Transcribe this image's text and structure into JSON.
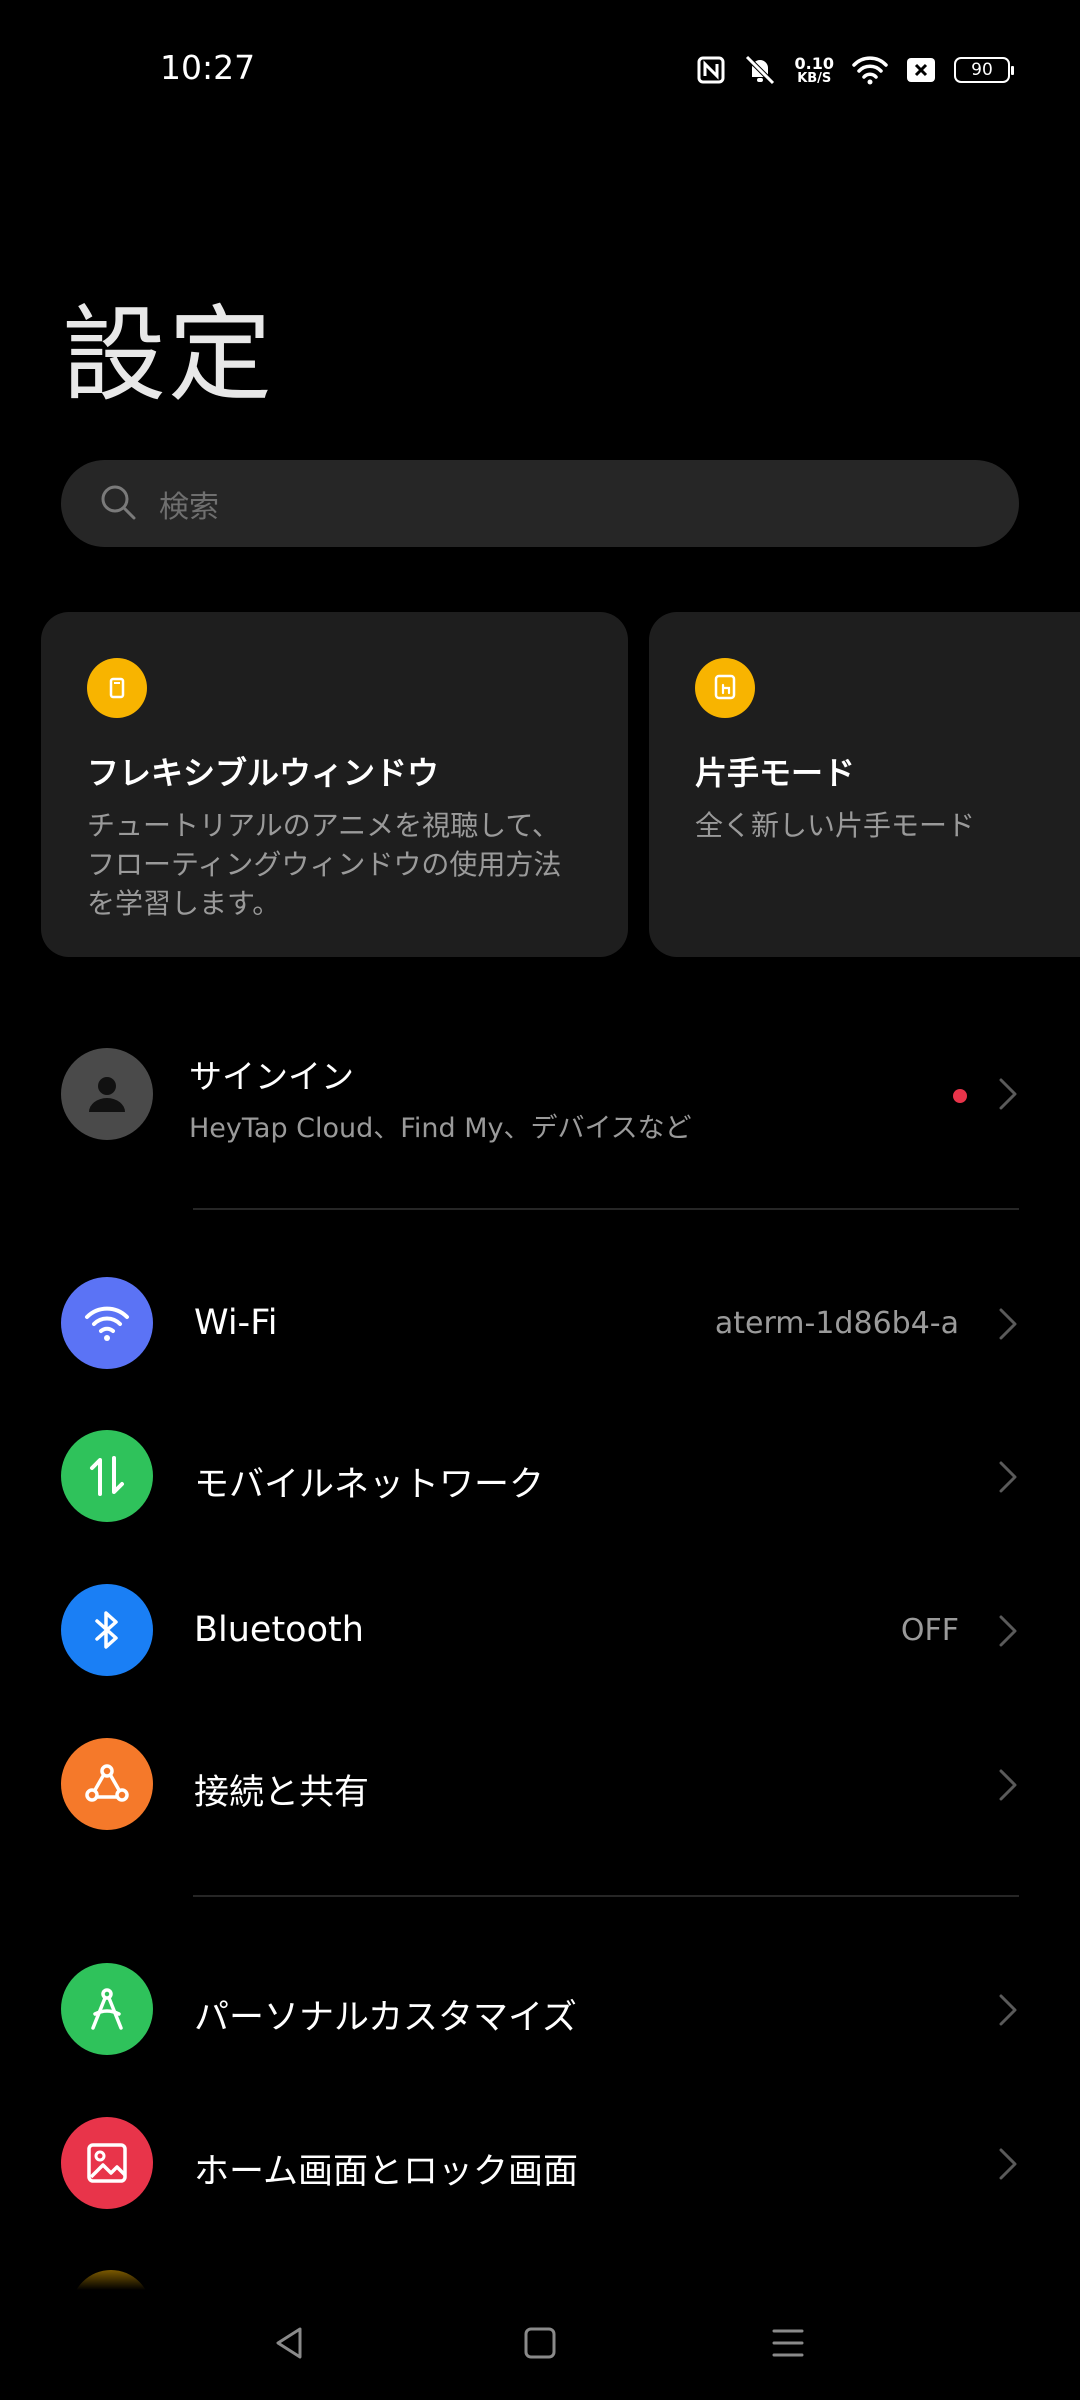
{
  "status_bar": {
    "time": "10:27",
    "speed_value": "0.10",
    "speed_unit": "KB/S",
    "battery": "90"
  },
  "page_title": "設定",
  "search": {
    "placeholder": "検索"
  },
  "cards": [
    {
      "title": "フレキシブルウィンドウ",
      "description": "チュートリアルのアニメを視聴して、フローティングウィンドウの使用方法を学習します。",
      "icon": "floating-window-icon"
    },
    {
      "title": "片手モード",
      "description": "全く新しい片手モード",
      "icon": "one-hand-icon"
    }
  ],
  "signin": {
    "title": "サインイン",
    "subtitle": "HeyTap Cloud、Find My、デバイスなど"
  },
  "rows": [
    {
      "label": "Wi-Fi",
      "value": "aterm-1d86b4-a",
      "icon": "wifi-icon",
      "color": "#5b73f5"
    },
    {
      "label": "モバイルネットワーク",
      "value": "",
      "icon": "mobile-data-icon",
      "color": "#2fc25b"
    },
    {
      "label": "Bluetooth",
      "value": "OFF",
      "icon": "bluetooth-icon",
      "color": "#1a7ff5"
    },
    {
      "label": "接続と共有",
      "value": "",
      "icon": "connection-share-icon",
      "color": "#f5792a"
    },
    {
      "label": "パーソナルカスタマイズ",
      "value": "",
      "icon": "personalize-icon",
      "color": "#2fc25b"
    },
    {
      "label": "ホーム画面とロック画面",
      "value": "",
      "icon": "wallpaper-icon",
      "color": "#e8344a"
    }
  ]
}
